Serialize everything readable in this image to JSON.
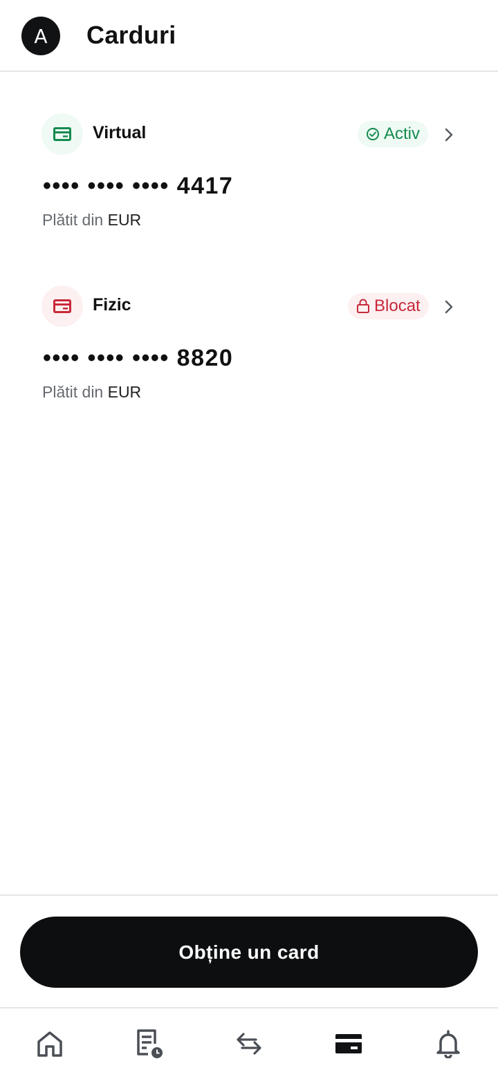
{
  "header": {
    "avatar_initial": "A",
    "title": "Carduri"
  },
  "cards": [
    {
      "type_label": "Virtual",
      "status_label": "Activ",
      "status": "active",
      "masked_number": "•••• •••• •••• 4417",
      "funding_prefix": "Plătit din",
      "funding_currency": "EUR",
      "icon": "card-icon",
      "accent_color": "#148a4f"
    },
    {
      "type_label": "Fizic",
      "status_label": "Blocat",
      "status": "blocked",
      "masked_number": "•••• •••• •••• 8820",
      "funding_prefix": "Plătit din",
      "funding_currency": "EUR",
      "icon": "card-icon",
      "accent_color": "#c8283a"
    }
  ],
  "cta": {
    "label": "Obține un card"
  },
  "tabbar": {
    "items": [
      {
        "name": "home",
        "icon": "home-icon",
        "active": false
      },
      {
        "name": "statements",
        "icon": "receipt-clock-icon",
        "active": false
      },
      {
        "name": "transfers",
        "icon": "arrows-swap-icon",
        "active": false
      },
      {
        "name": "cards",
        "icon": "card-icon",
        "active": true
      },
      {
        "name": "notifications",
        "icon": "bell-icon",
        "active": false
      }
    ]
  },
  "colors": {
    "success": "#148a4f",
    "danger": "#c8283a",
    "primary_button": "#0d0e10",
    "muted_text": "#666a70"
  }
}
